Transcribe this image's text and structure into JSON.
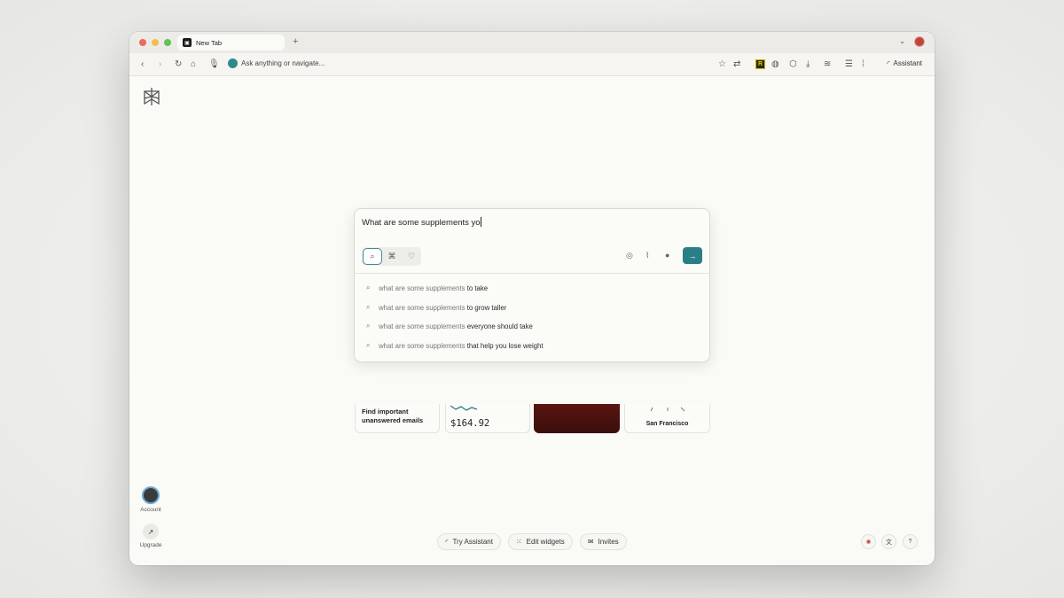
{
  "browser": {
    "tab_title": "New Tab",
    "new_tab_symbol": "+",
    "omnibox_placeholder": "Ask anything or navigate...",
    "assistant_label": "Assistant",
    "extension_badge": "R"
  },
  "search": {
    "query": "What are some supplements yo",
    "suggestions": [
      {
        "prefix": "what are some supplements ",
        "highlight": "to take"
      },
      {
        "prefix": "what are some supplements ",
        "highlight": "to grow taller"
      },
      {
        "prefix": "what are some supplements ",
        "highlight": "everyone should take"
      },
      {
        "prefix": "what are some supplements ",
        "highlight": "that help you lose weight"
      }
    ]
  },
  "widgets": {
    "email_text": "Find important unanswered emails",
    "price": "$164.92",
    "city": "San Francisco"
  },
  "sidebar": {
    "account_label": "Account",
    "upgrade_label": "Upgrade"
  },
  "bottom": {
    "try_assistant": "Try Assistant",
    "edit_widgets": "Edit widgets",
    "invites": "Invites"
  },
  "colors": {
    "accent": "#2a7f86",
    "tab_avatar": "#c0433c"
  }
}
